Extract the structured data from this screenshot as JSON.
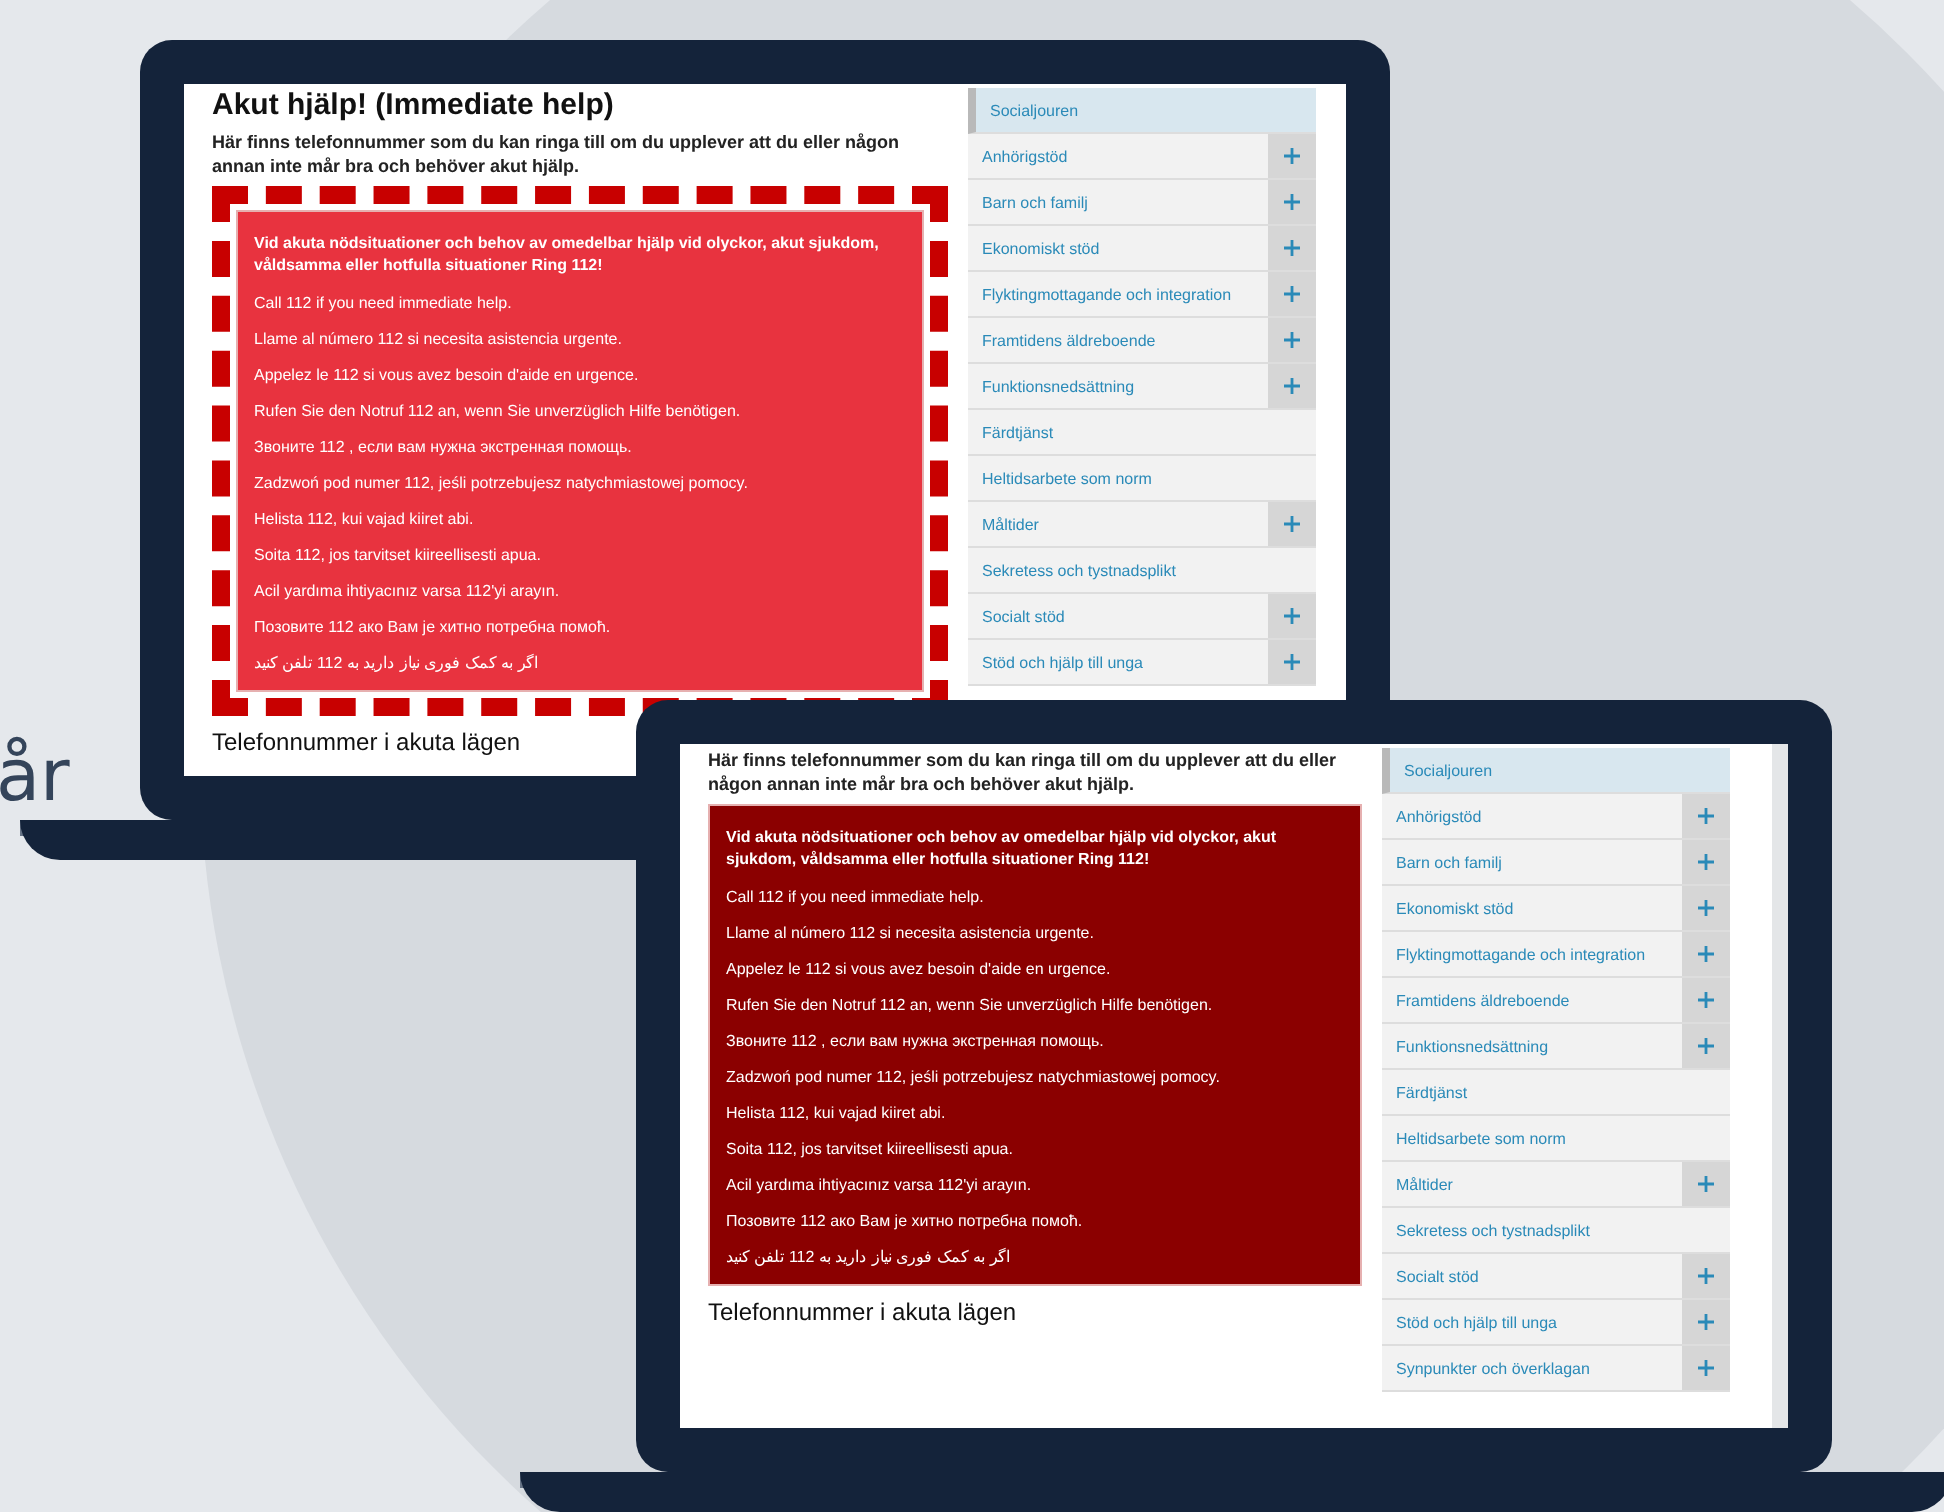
{
  "background_text": "år",
  "laptops": [
    {
      "highlighted": true,
      "color": "#e8333f",
      "heading": "Akut hjälp! (Immediate help)",
      "intro": "Här finns telefonnummer som du kan ringa till om du upplever att du eller någon annan inte mår bra och behöver akut hjälp.",
      "alert": {
        "lead": "Vid akuta nödsituationer och behov av omedelbar hjälp vid olyckor, akut sjukdom, våldsamma eller hotfulla situationer Ring 112!",
        "lines": [
          "Call 112 if you need immediate help.",
          "Llame al número 112 si necesita asistencia urgente.",
          "Appelez le 112 si vous avez besoin d'aide en urgence.",
          "Rufen Sie den Notruf 112 an, wenn Sie unverzüglich Hilfe benötigen.",
          "Звоните 112 , если вам нужна экстренная помощь.",
          "Zadzwoń pod numer 112, jeśli potrzebujesz natychmiastowej pomocy.",
          "Helista 112, kui vajad kiiret abi.",
          "Soita 112, jos tarvitset kiireellisesti apua.",
          "Acil yardıma ihtiyacınız varsa 112'yi arayın.",
          "Позовите 112 ако Вам је хитно потребна помоћ.",
          "اگر به کمک فوری نیاز دارید به 112 تلفن کنید"
        ]
      },
      "section_heading": "Telefonnummer i akuta lägen",
      "menu": [
        {
          "label": "Socialjouren",
          "expandable": false,
          "selected": true
        },
        {
          "label": "Anhörigstöd",
          "expandable": true,
          "selected": false
        },
        {
          "label": "Barn och familj",
          "expandable": true,
          "selected": false
        },
        {
          "label": "Ekonomiskt stöd",
          "expandable": true,
          "selected": false
        },
        {
          "label": "Flyktingmottagande och integration",
          "expandable": true,
          "selected": false
        },
        {
          "label": "Framtidens äldreboende",
          "expandable": true,
          "selected": false
        },
        {
          "label": "Funktionsnedsättning",
          "expandable": true,
          "selected": false
        },
        {
          "label": "Färdtjänst",
          "expandable": false,
          "selected": false
        },
        {
          "label": "Heltidsarbete som norm",
          "expandable": false,
          "selected": false
        },
        {
          "label": "Måltider",
          "expandable": true,
          "selected": false
        },
        {
          "label": "Sekretess och tystnadsplikt",
          "expandable": false,
          "selected": false
        },
        {
          "label": "Socialt stöd",
          "expandable": true,
          "selected": false
        },
        {
          "label": "Stöd och hjälp till unga",
          "expandable": true,
          "selected": false
        }
      ]
    },
    {
      "highlighted": false,
      "color": "#8b0000",
      "intro": "Här finns telefonnummer som du kan ringa till om du upplever att du eller någon annan inte mår bra och behöver akut hjälp.",
      "alert": {
        "lead": "Vid akuta nödsituationer och behov av omedelbar hjälp vid olyckor, akut sjukdom, våldsamma eller hotfulla situationer Ring 112!",
        "lines": [
          "Call 112 if you need immediate help.",
          "Llame al número 112 si necesita asistencia urgente.",
          "Appelez le 112 si vous avez besoin d'aide en urgence.",
          "Rufen Sie den Notruf 112 an, wenn Sie unverzüglich Hilfe benötigen.",
          "Звоните 112 , если вам нужна экстренная помощь.",
          "Zadzwoń pod numer 112, jeśli potrzebujesz natychmiastowej pomocy.",
          "Helista 112, kui vajad kiiret abi.",
          "Soita 112, jos tarvitset kiireellisesti apua.",
          "Acil yardıma ihtiyacınız varsa 112'yi arayın.",
          "Позовите 112 ако Вам је хитно потребна помоћ.",
          "اگر به کمک فوری نیاز دارید به 112 تلفن کنید"
        ]
      },
      "section_heading": "Telefonnummer i akuta lägen",
      "menu": [
        {
          "label": "Socialjouren",
          "expandable": false,
          "selected": true
        },
        {
          "label": "Anhörigstöd",
          "expandable": true,
          "selected": false
        },
        {
          "label": "Barn och familj",
          "expandable": true,
          "selected": false
        },
        {
          "label": "Ekonomiskt stöd",
          "expandable": true,
          "selected": false
        },
        {
          "label": "Flyktingmottagande och integration",
          "expandable": true,
          "selected": false
        },
        {
          "label": "Framtidens äldreboende",
          "expandable": true,
          "selected": false
        },
        {
          "label": "Funktionsnedsättning",
          "expandable": true,
          "selected": false
        },
        {
          "label": "Färdtjänst",
          "expandable": false,
          "selected": false
        },
        {
          "label": "Heltidsarbete som norm",
          "expandable": false,
          "selected": false
        },
        {
          "label": "Måltider",
          "expandable": true,
          "selected": false
        },
        {
          "label": "Sekretess och tystnadsplikt",
          "expandable": false,
          "selected": false
        },
        {
          "label": "Socialt stöd",
          "expandable": true,
          "selected": false
        },
        {
          "label": "Stöd och hjälp till unga",
          "expandable": true,
          "selected": false
        },
        {
          "label": "Synpunkter och överklagan",
          "expandable": true,
          "selected": false
        }
      ]
    }
  ]
}
